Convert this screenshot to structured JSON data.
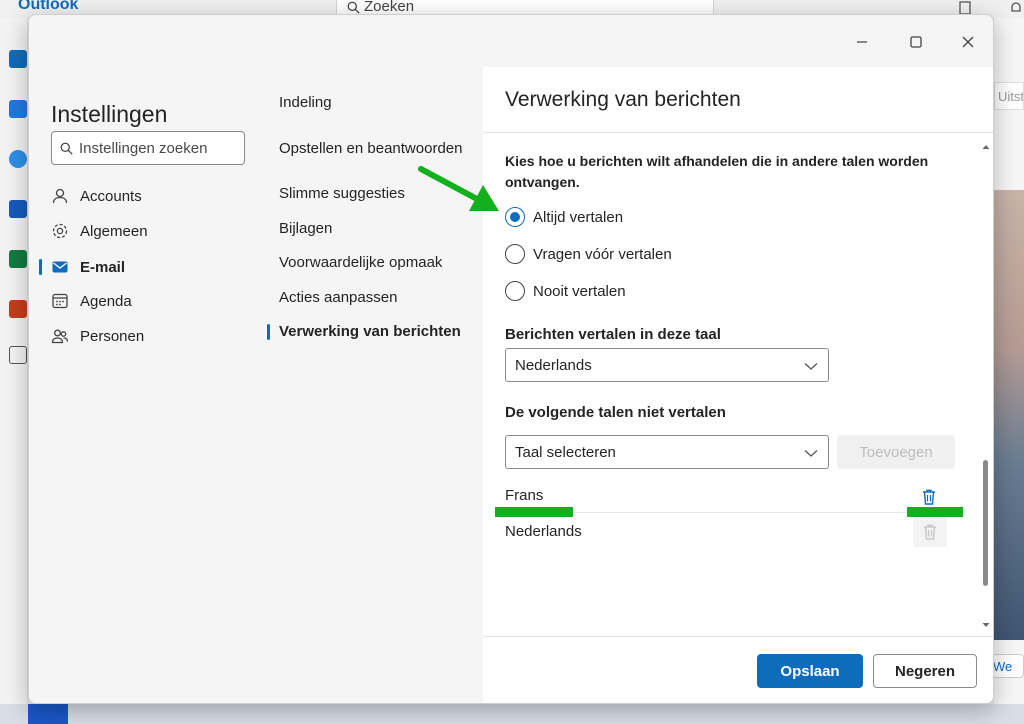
{
  "background": {
    "brand": "Outlook",
    "search_placeholder": "Zoeken",
    "right_hint": "Uitst",
    "bottom_hint": "We"
  },
  "settings": {
    "title": "Instellingen",
    "search_placeholder": "Instellingen zoeken",
    "categories": [
      {
        "label": "Accounts",
        "icon": "person-icon"
      },
      {
        "label": "Algemeen",
        "icon": "gear-icon"
      },
      {
        "label": "E-mail",
        "icon": "mail-icon",
        "active": true
      },
      {
        "label": "Agenda",
        "icon": "calendar-icon"
      },
      {
        "label": "Personen",
        "icon": "people-icon"
      }
    ],
    "subcategories": [
      {
        "label": "Indeling"
      },
      {
        "label": "Opstellen en beantwoorden"
      },
      {
        "label": "Slimme suggesties"
      },
      {
        "label": "Bijlagen"
      },
      {
        "label": "Voorwaardelijke opmaak"
      },
      {
        "label": "Acties aanpassen"
      },
      {
        "label": "Verwerking van berichten",
        "active": true
      }
    ]
  },
  "content": {
    "title": "Verwerking van berichten",
    "question": "Kies hoe u berichten wilt afhandelen die in andere talen worden ontvangen.",
    "options": [
      {
        "label": "Altijd vertalen",
        "selected": true
      },
      {
        "label": "Vragen vóór vertalen",
        "selected": false
      },
      {
        "label": "Nooit vertalen",
        "selected": false
      }
    ],
    "translate_label": "Berichten vertalen in deze taal",
    "translate_value": "Nederlands",
    "no_translate_label": "De volgende talen niet vertalen",
    "language_select_placeholder": "Taal selecteren",
    "add_button": "Toevoegen",
    "languages": [
      {
        "label": "Frans"
      },
      {
        "label": "Nederlands"
      }
    ]
  },
  "footer": {
    "save": "Opslaan",
    "discard": "Negeren"
  },
  "colors": {
    "accent": "#0f6cbd",
    "annotation": "#12b01c"
  }
}
